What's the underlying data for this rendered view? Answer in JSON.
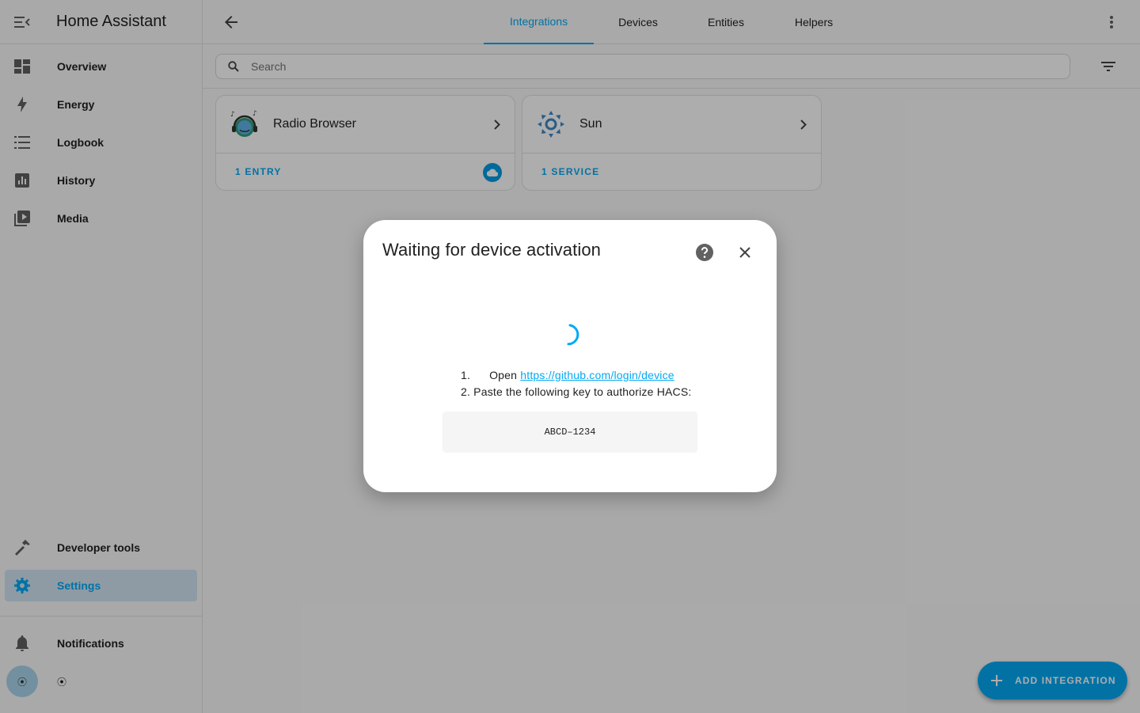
{
  "app": {
    "title": "Home Assistant"
  },
  "sidebar": {
    "items": [
      {
        "label": "Overview",
        "icon": "dashboard-icon"
      },
      {
        "label": "Energy",
        "icon": "lightning-bolt-icon"
      },
      {
        "label": "Logbook",
        "icon": "list-icon"
      },
      {
        "label": "History",
        "icon": "chart-box-icon"
      },
      {
        "label": "Media",
        "icon": "play-box-multiple-icon"
      }
    ],
    "bottom_items": [
      {
        "label": "Developer tools",
        "icon": "hammer-icon"
      },
      {
        "label": "Settings",
        "icon": "cog-icon",
        "active": true
      }
    ],
    "notifications_label": "Notifications",
    "user": {
      "avatar_glyph": "⦿",
      "name_glyph": "⦿"
    }
  },
  "topbar": {
    "tabs": [
      {
        "label": "Integrations",
        "active": true
      },
      {
        "label": "Devices"
      },
      {
        "label": "Entities"
      },
      {
        "label": "Helpers"
      }
    ]
  },
  "search": {
    "placeholder": "Search",
    "value": ""
  },
  "cards": [
    {
      "title": "Radio Browser",
      "link": "1 ENTRY",
      "icon": "radio-browser-logo-icon",
      "cloud_badge": true
    },
    {
      "title": "Sun",
      "link": "1 SERVICE",
      "icon": "sun-logo-icon",
      "cloud_badge": false
    }
  ],
  "fab": {
    "label": "ADD INTEGRATION"
  },
  "dialog": {
    "title": "Waiting for device activation",
    "step1_num": "1.",
    "step1_text": "Open",
    "step1_link": "https://github.com/login/device",
    "step2_num": "2.",
    "step2_text": "Paste the following key to authorize HACS:",
    "code": "ABCD–1234"
  },
  "colors": {
    "primary": "#03a9f4",
    "active_bg": "#d1e5f4",
    "scrim": "rgba(0,0,0,0.32)"
  }
}
